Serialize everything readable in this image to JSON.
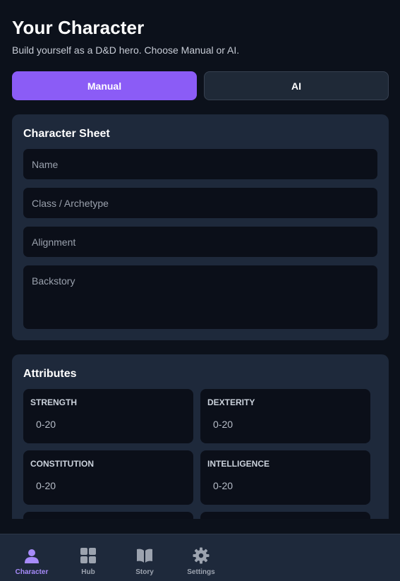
{
  "header": {
    "title": "Your Character",
    "subtitle": "Build yourself as a D&D hero. Choose Manual or AI."
  },
  "mode_toggle": {
    "manual_label": "Manual",
    "ai_label": "AI",
    "selected": "Manual"
  },
  "character_sheet": {
    "title": "Character Sheet",
    "fields": {
      "name_placeholder": "Name",
      "class_placeholder": "Class / Archetype",
      "alignment_placeholder": "Alignment",
      "backstory_placeholder": "Backstory"
    }
  },
  "attributes": {
    "title": "Attributes",
    "items": [
      {
        "label": "STRENGTH",
        "placeholder": "0-20"
      },
      {
        "label": "DEXTERITY",
        "placeholder": "0-20"
      },
      {
        "label": "CONSTITUTION",
        "placeholder": "0-20"
      },
      {
        "label": "INTELLIGENCE",
        "placeholder": "0-20"
      }
    ]
  },
  "bottom_nav": {
    "items": [
      {
        "label": "Character",
        "icon": "person-icon",
        "active": true
      },
      {
        "label": "Hub",
        "icon": "grid-icon",
        "active": false
      },
      {
        "label": "Story",
        "icon": "book-icon",
        "active": false
      },
      {
        "label": "Settings",
        "icon": "gear-icon",
        "active": false
      }
    ]
  },
  "colors": {
    "accent": "#8b5cf6",
    "background": "#0c111b",
    "card": "#1e293b",
    "input": "#0b0f19"
  }
}
